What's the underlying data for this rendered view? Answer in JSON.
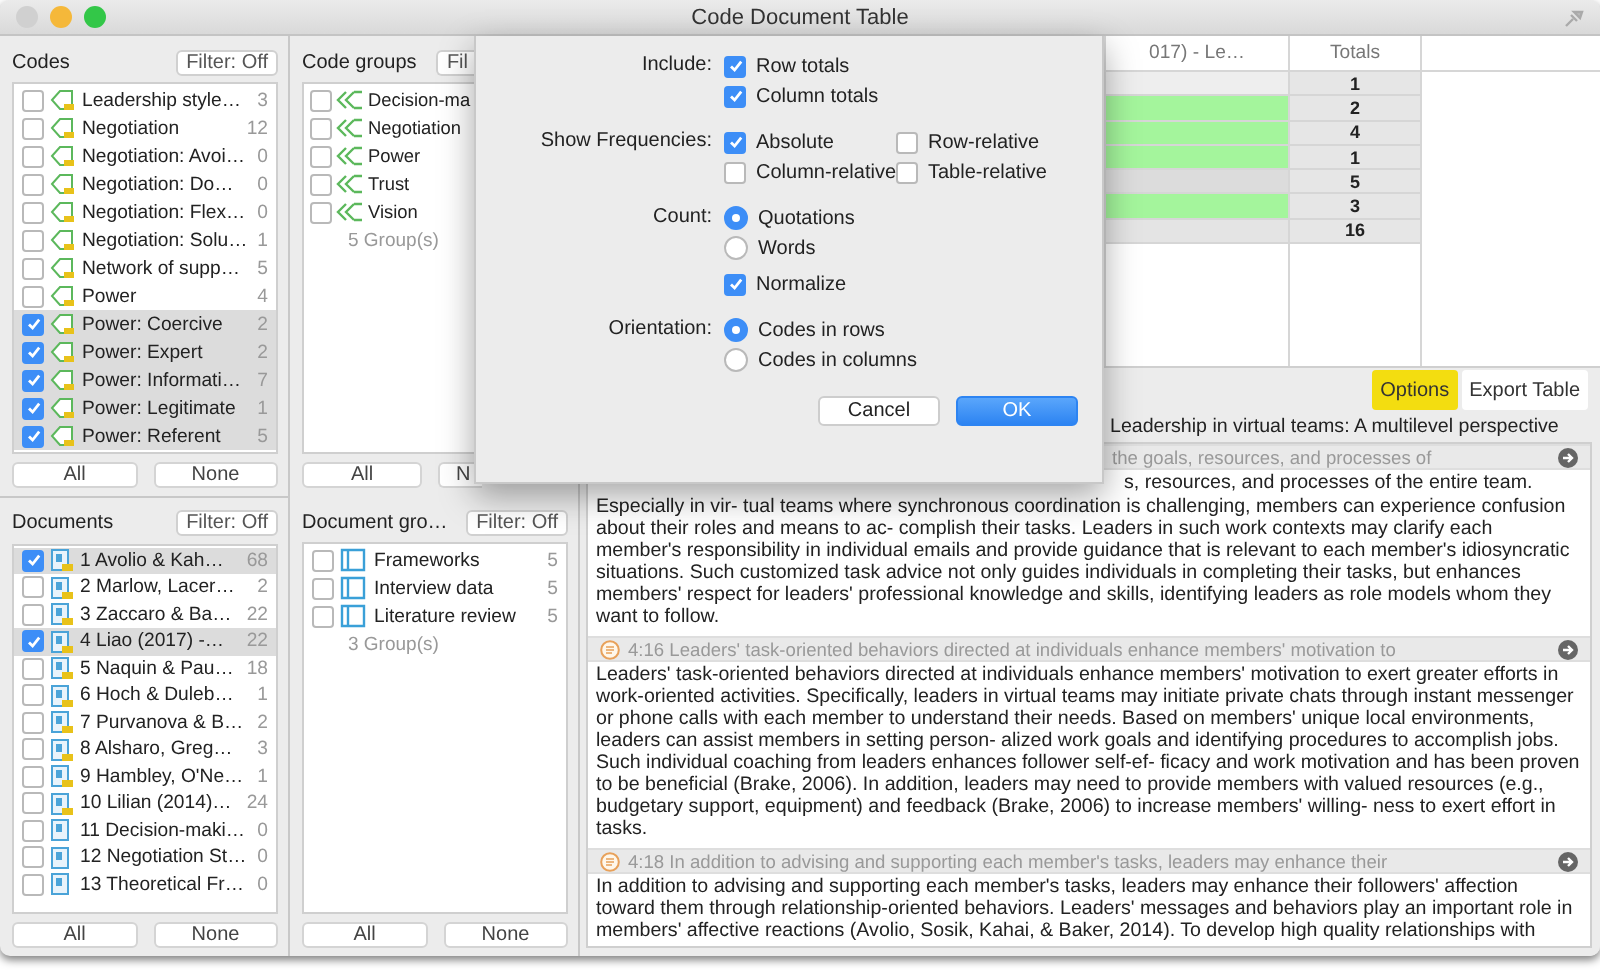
{
  "window": {
    "title": "Code Document Table"
  },
  "codes": {
    "heading": "Codes",
    "filter": "Filter: Off",
    "buttons": [
      "All",
      "None"
    ],
    "items": [
      {
        "name": "Leadership style…",
        "count": "3",
        "checked": false
      },
      {
        "name": "Negotiation",
        "count": "12",
        "checked": false
      },
      {
        "name": "Negotiation: Avoi…",
        "count": "0",
        "checked": false
      },
      {
        "name": "Negotiation: Do…",
        "count": "0",
        "checked": false
      },
      {
        "name": "Negotiation: Flex…",
        "count": "0",
        "checked": false
      },
      {
        "name": "Negotiation: Solu…",
        "count": "1",
        "checked": false
      },
      {
        "name": "Network of supp…",
        "count": "5",
        "checked": false
      },
      {
        "name": "Power",
        "count": "4",
        "checked": false
      },
      {
        "name": "Power: Coercive",
        "count": "2",
        "checked": true
      },
      {
        "name": "Power: Expert",
        "count": "2",
        "checked": true
      },
      {
        "name": "Power: Informati…",
        "count": "7",
        "checked": true
      },
      {
        "name": "Power: Legitimate",
        "count": "1",
        "checked": true
      },
      {
        "name": "Power: Referent",
        "count": "5",
        "checked": true
      }
    ]
  },
  "documents": {
    "heading": "Documents",
    "filter": "Filter: Off",
    "buttons": [
      "All",
      "None"
    ],
    "items": [
      {
        "name": "1 Avolio & Kah…",
        "count": "68",
        "checked": true,
        "coded": true
      },
      {
        "name": "2 Marlow, Lacer…",
        "count": "2",
        "checked": false,
        "coded": true
      },
      {
        "name": "3 Zaccaro & Ba…",
        "count": "22",
        "checked": false,
        "coded": true
      },
      {
        "name": "4 Liao (2017) -…",
        "count": "22",
        "checked": true,
        "coded": true
      },
      {
        "name": "5 Naquin & Pau…",
        "count": "18",
        "checked": false,
        "coded": true
      },
      {
        "name": "6 Hoch & Duleb…",
        "count": "1",
        "checked": false,
        "coded": true
      },
      {
        "name": "7 Purvanova & B…",
        "count": "2",
        "checked": false,
        "coded": true
      },
      {
        "name": "8 Alsharo, Greg…",
        "count": "3",
        "checked": false,
        "coded": true
      },
      {
        "name": "9 Hambley, O'Ne…",
        "count": "1",
        "checked": false,
        "coded": true
      },
      {
        "name": "10 Lilian (2014)…",
        "count": "24",
        "checked": false,
        "coded": true
      },
      {
        "name": "11 Decision-maki…",
        "count": "0",
        "checked": false,
        "coded": false
      },
      {
        "name": "12 Negotiation St…",
        "count": "0",
        "checked": false,
        "coded": false
      },
      {
        "name": "13 Theoretical Fr…",
        "count": "0",
        "checked": false,
        "coded": false
      }
    ]
  },
  "code_groups": {
    "heading": "Code groups",
    "filter": "Fil",
    "summary": "5 Group(s)",
    "buttons": [
      "All",
      "N"
    ],
    "items": [
      {
        "name": "Decision-ma",
        "checked": false
      },
      {
        "name": "Negotiation",
        "checked": false
      },
      {
        "name": "Power",
        "checked": false
      },
      {
        "name": "Trust",
        "checked": false
      },
      {
        "name": "Vision",
        "checked": false
      }
    ]
  },
  "document_groups": {
    "heading": "Document gro…",
    "filter": "Filter: Off",
    "summary": "3 Group(s)",
    "buttons": [
      "All",
      "None"
    ],
    "items": [
      {
        "name": "Frameworks",
        "count": "5",
        "checked": false
      },
      {
        "name": "Interview data",
        "count": "5",
        "checked": false
      },
      {
        "name": "Literature review",
        "count": "5",
        "checked": false
      }
    ]
  },
  "table": {
    "columns": [
      "017) - Le…",
      "Totals"
    ],
    "rows": [
      {
        "color": "#eeeeee",
        "total": "1"
      },
      {
        "color": "#a4f59c",
        "total": "2"
      },
      {
        "color": "#a4f59c",
        "total": "4"
      },
      {
        "color": "#a4f59c",
        "total": "1"
      },
      {
        "color": "#dcdcdc",
        "total": "5"
      },
      {
        "color": "#a4f59c",
        "total": "3"
      },
      {
        "color": "#e4e4e4",
        "total": "16"
      }
    ]
  },
  "toolbar": {
    "buttons": [
      {
        "label": "Options",
        "highlighted": true
      },
      {
        "label": "Export Table",
        "highlighted": false
      }
    ]
  },
  "document_title": "Leadership in virtual teams: A multilevel perspective",
  "quotations": [
    {
      "kind": "partial",
      "header": "the goals, resources, and processes of",
      "lead": "s, resources, and processes of the entire team.",
      "body": "Especially in vir- tual teams where synchronous coordination is challenging, members can experience confusion about their roles and means to ac- complish their tasks. Leaders in such work contexts may clarify each member's responsibility in individual emails and provide guidance that is relevant to each member's idiosyncratic situations. Such customized task advice not only guides individuals in completing their tasks, but enhances members' respect for leaders' professional knowledge and skills, identifying leaders as role models whom they want to follow."
    },
    {
      "kind": "full",
      "header": "4:16 Leaders' task-oriented behaviors directed at individuals enhance members' motivation to",
      "body": "Leaders' task-oriented behaviors directed at individuals enhance members' motivation to exert greater efforts in work-oriented activities. Specifically, leaders in virtual teams may initiate private chats through instant messenger or phone calls with each member to understand their needs. Based on members' unique local environments, leaders can assist members in setting person- alized work goals and identifying procedures to accomplish jobs. Such individual coaching from leaders enhances follower self-ef- ficacy and work motivation and has been proven to be beneficial (Brake, 2006). In addition, leaders may need to provide members with valued resources (e.g., budgetary support, equipment) and feedback (Brake, 2006) to increase members' willing- ness to exert effort in tasks."
    },
    {
      "kind": "full",
      "header": "4:18 In addition to advising and supporting each member's tasks, leaders may enhance their",
      "body": "In addition to advising and supporting each member's tasks, leaders may enhance their followers' affection toward them through relationship-oriented behaviors. Leaders' messages and behaviors play an important role in members' affective reactions (Avolio, Sosik, Kahai, & Baker, 2014). To develop high quality relationships with"
    }
  ],
  "dialog": {
    "sections": [
      {
        "label": "Include:",
        "rows": [
          [
            {
              "kind": "checkbox",
              "label": "Row totals",
              "checked": true
            }
          ],
          [
            {
              "kind": "checkbox",
              "label": "Column totals",
              "checked": true
            }
          ]
        ]
      },
      {
        "label": "Show Frequencies:",
        "rows": [
          [
            {
              "kind": "checkbox",
              "label": "Absolute",
              "checked": true
            },
            {
              "kind": "checkbox",
              "label": "Row-relative",
              "checked": false
            }
          ],
          [
            {
              "kind": "checkbox",
              "label": "Column-relative",
              "checked": false
            },
            {
              "kind": "checkbox",
              "label": "Table-relative",
              "checked": false
            }
          ]
        ]
      },
      {
        "label": "Count:",
        "rows": [
          [
            {
              "kind": "radio",
              "label": "Quotations",
              "selected": true
            }
          ],
          [
            {
              "kind": "radio",
              "label": "Words",
              "selected": false
            }
          ],
          [
            {
              "kind": "checkbox",
              "label": "Normalize",
              "checked": true
            }
          ]
        ]
      },
      {
        "label": "Orientation:",
        "rows": [
          [
            {
              "kind": "radio",
              "label": "Codes in rows",
              "selected": true
            }
          ],
          [
            {
              "kind": "radio",
              "label": "Codes in columns",
              "selected": false
            }
          ]
        ]
      }
    ],
    "buttons": [
      {
        "label": "Cancel",
        "default": false
      },
      {
        "label": "OK",
        "default": true
      }
    ]
  }
}
